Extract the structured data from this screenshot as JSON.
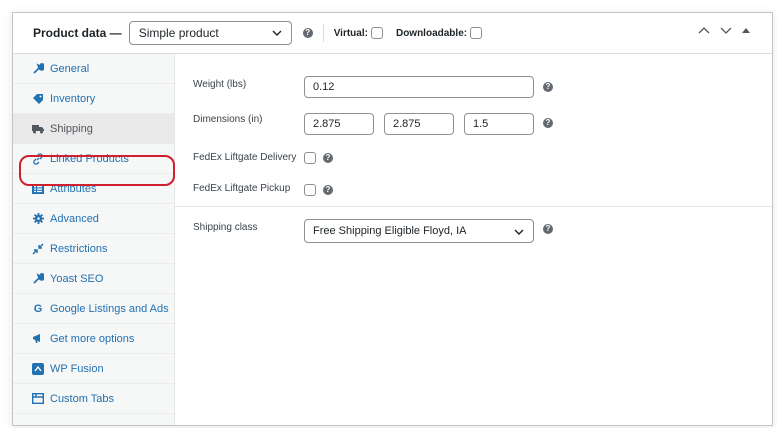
{
  "header": {
    "title": "Product data —",
    "product_type": "Simple product",
    "virtual_label": "Virtual:",
    "downloadable_label": "Downloadable:",
    "help": "?"
  },
  "sidebar": {
    "items": [
      {
        "label": "General",
        "icon": "wrench-icon"
      },
      {
        "label": "Inventory",
        "icon": "tag-icon"
      },
      {
        "label": "Shipping",
        "icon": "truck-icon",
        "active": true
      },
      {
        "label": "Linked Products",
        "icon": "link-icon"
      },
      {
        "label": "Attributes",
        "icon": "list-icon"
      },
      {
        "label": "Advanced",
        "icon": "gear-icon"
      },
      {
        "label": "Restrictions",
        "icon": "arrows-icon"
      },
      {
        "label": "Yoast SEO",
        "icon": "wrench-icon"
      },
      {
        "label": "Google Listings and Ads",
        "icon": "google-icon"
      },
      {
        "label": "Get more options",
        "icon": "megaphone-icon"
      },
      {
        "label": "WP Fusion",
        "icon": "wpfusion-icon"
      },
      {
        "label": "Custom Tabs",
        "icon": "tabs-icon"
      }
    ]
  },
  "shipping": {
    "weight_label": "Weight (lbs)",
    "weight_value": "0.12",
    "dimensions_label": "Dimensions (in)",
    "length": "2.875",
    "width": "2.875",
    "height": "1.5",
    "fedex_delivery_label": "FedEx Liftgate Delivery",
    "fedex_pickup_label": "FedEx Liftgate Pickup",
    "shipping_class_label": "Shipping class",
    "shipping_class_value": "Free Shipping Eligible Floyd, IA"
  },
  "colors": {
    "link": "#2271b1",
    "highlight": "#d0202e"
  }
}
